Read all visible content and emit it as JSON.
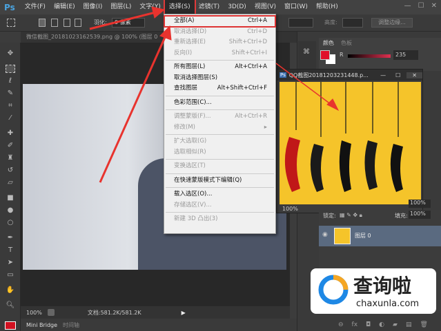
{
  "app": {
    "logo": "Ps"
  },
  "menubar": [
    "文件(F)",
    "编辑(E)",
    "图像(I)",
    "图层(L)",
    "文字(Y)",
    "选择(S)",
    "滤镜(T)",
    "3D(D)",
    "视图(V)",
    "窗口(W)",
    "帮助(H)"
  ],
  "window_controls": [
    "—",
    "☐",
    "✕"
  ],
  "options": {
    "feather_label": "羽化:",
    "feather_value": "0 像素",
    "height_label": "高度:",
    "refine_edge": "调整边缘..."
  },
  "document": {
    "tab": "微信截图_20181023162539.png @ 100% (图层 0",
    "zoom": "100%",
    "doc_info": "文档:581.2K/581.2K"
  },
  "bottom_tabs": [
    "Mini Bridge",
    "时间轴"
  ],
  "select_menu": [
    [
      {
        "label": "全部(A)",
        "shortcut": "Ctrl+A",
        "enabled": true
      },
      {
        "label": "取消选择(D)",
        "shortcut": "Ctrl+D",
        "enabled": false
      },
      {
        "label": "重新选择(E)",
        "shortcut": "Shift+Ctrl+D",
        "enabled": false
      },
      {
        "label": "反向(I)",
        "shortcut": "Shift+Ctrl+I",
        "enabled": false
      }
    ],
    [
      {
        "label": "所有图层(L)",
        "shortcut": "Alt+Ctrl+A",
        "enabled": true
      },
      {
        "label": "取消选择图层(S)",
        "shortcut": "",
        "enabled": true
      },
      {
        "label": "查找图层",
        "shortcut": "Alt+Shift+Ctrl+F",
        "enabled": true
      }
    ],
    [
      {
        "label": "色彩范围(C)...",
        "shortcut": "",
        "enabled": true
      }
    ],
    [
      {
        "label": "调整蒙版(F)...",
        "shortcut": "Alt+Ctrl+R",
        "enabled": false
      },
      {
        "label": "修改(M)",
        "shortcut": "▸",
        "enabled": false
      }
    ],
    [
      {
        "label": "扩大选取(G)",
        "shortcut": "",
        "enabled": false
      },
      {
        "label": "选取相似(R)",
        "shortcut": "",
        "enabled": false
      }
    ],
    [
      {
        "label": "变换选区(T)",
        "shortcut": "",
        "enabled": false
      }
    ],
    [
      {
        "label": "在快速蒙版模式下编辑(Q)",
        "shortcut": "",
        "enabled": true
      }
    ],
    [
      {
        "label": "载入选区(O)...",
        "shortcut": "",
        "enabled": true
      },
      {
        "label": "存储选区(V)...",
        "shortcut": "",
        "enabled": false
      }
    ],
    [
      {
        "label": "新建 3D 凸出(3)",
        "shortcut": "",
        "enabled": false
      }
    ]
  ],
  "color_panel": {
    "tabs": [
      "颜色",
      "色板"
    ],
    "channel": "R",
    "value": "235",
    "fg": "#e0102a"
  },
  "float_window": {
    "title": "QQ截图20181203231448.p...",
    "zoom": "100%"
  },
  "layers": {
    "lock_label": "锁定:",
    "fill_label": "填充:",
    "fill_value": "100%",
    "opacity_value": "100%",
    "layer_name": "图层 0"
  },
  "watermark": {
    "brand": "查询啦",
    "url": "chaxunla.com"
  },
  "colors": {
    "accent_red": "#e03a3a",
    "yellow": "#f5c42a"
  }
}
